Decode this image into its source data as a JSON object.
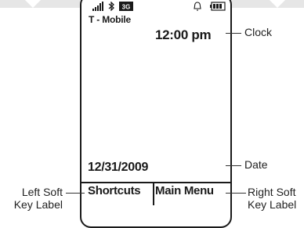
{
  "status_bar": {
    "icons": [
      "signal-strength-icon",
      "bluetooth-icon",
      "data-network-icon",
      "alarm-bell-icon",
      "battery-icon"
    ],
    "badge_text": "3G"
  },
  "screen": {
    "carrier": "T - Mobile",
    "clock": "12:00 pm",
    "date": "12/31/2009"
  },
  "softkeys": {
    "left": "Shortcuts",
    "right": "Main Menu"
  },
  "callouts": {
    "clock": "Clock",
    "date": "Date",
    "left_softkey": [
      "Left Soft",
      "Key Label"
    ],
    "right_softkey": [
      "Right Soft",
      "Key Label"
    ]
  }
}
